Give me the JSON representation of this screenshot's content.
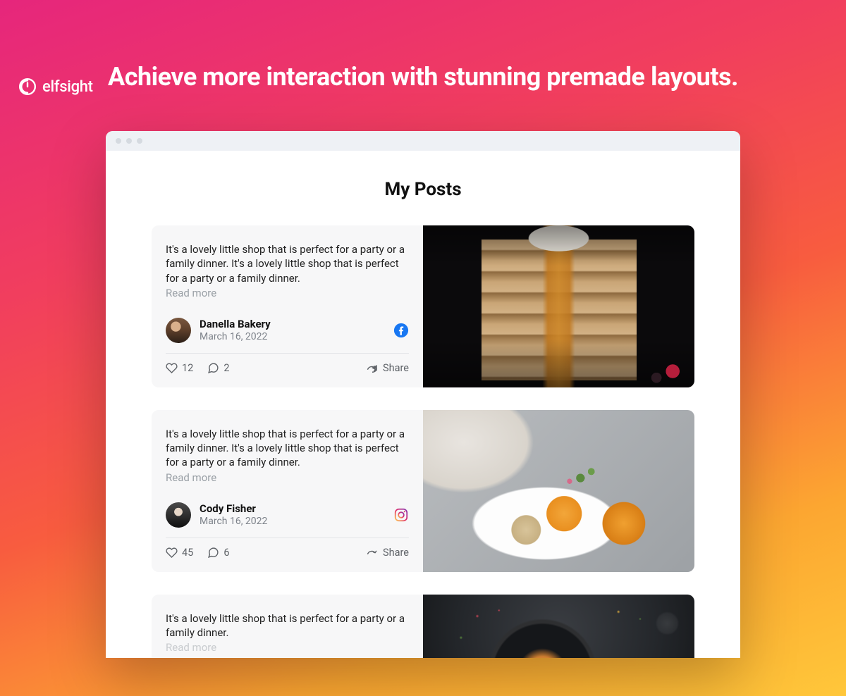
{
  "brand": "elfsight",
  "headline": "Achieve more interaction with stunning premade layouts.",
  "content_title": "My Posts",
  "read_more_label": "Read more",
  "share_label": "Share",
  "posts": [
    {
      "text": "It's a lovely little shop that is perfect for a party or a family dinner. It's a lovely little shop that is perfect for a party or a family dinner.",
      "author": "Danella Bakery",
      "date": "March 16, 2022",
      "platform": "facebook",
      "likes": "12",
      "comments": "2"
    },
    {
      "text": "It's a lovely little shop that is perfect for a party or a family dinner. It's a lovely little shop that is perfect for a party or a family dinner.",
      "author": "Cody Fisher",
      "date": "March 16, 2022",
      "platform": "instagram",
      "likes": "45",
      "comments": "6"
    },
    {
      "text": "It's a lovely little shop that is perfect for a party or a family dinner.",
      "author": "",
      "date": "",
      "platform": "",
      "likes": "",
      "comments": ""
    }
  ]
}
